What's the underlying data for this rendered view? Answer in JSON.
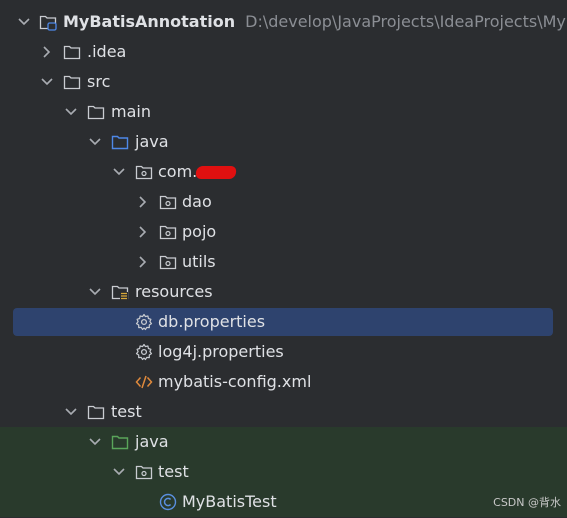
{
  "project": {
    "name": "MyBatisAnnotation",
    "path": "D:\\develop\\JavaProjects\\IdeaProjects\\MyBa"
  },
  "nodes": {
    "idea": ".idea",
    "src": "src",
    "main": "main",
    "java_main": "java",
    "pkg": "com.",
    "dao": "dao",
    "pojo": "pojo",
    "utils": "utils",
    "resources": "resources",
    "db_props": "db.properties",
    "log4j_props": "log4j.properties",
    "mybatis_xml": "mybatis-config.xml",
    "test": "test",
    "java_test": "java",
    "test_pkg": "test",
    "test_class": "MyBatisTest"
  },
  "watermark": "CSDN @背水",
  "colors": {
    "selection": "#2e436e",
    "test_background": "#293a2c",
    "source_folder": "#4e88e8",
    "test_folder": "#5aa55a",
    "xml_icon": "#e08a3c",
    "class_icon": "#5a8fe0"
  }
}
